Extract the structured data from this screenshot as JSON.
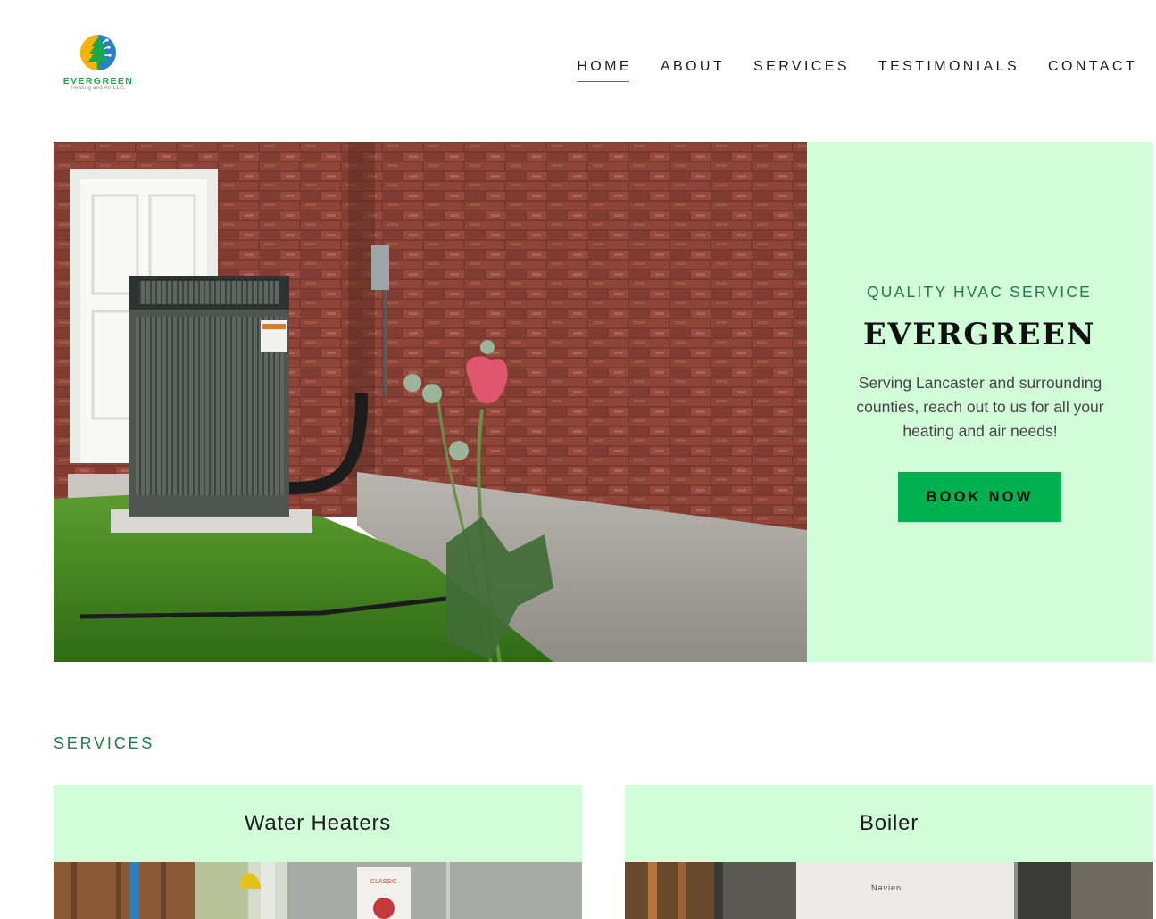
{
  "brand": {
    "name": "EVERGREEN",
    "tagline": "Heating and Air LLC.",
    "colors": {
      "green": "#1aa94a",
      "yellow": "#f5b400",
      "blue": "#2a7fc7"
    }
  },
  "nav": {
    "items": [
      {
        "label": "HOME",
        "active": true
      },
      {
        "label": "ABOUT",
        "active": false
      },
      {
        "label": "SERVICES",
        "active": false
      },
      {
        "label": "TESTIMONIALS",
        "active": false
      },
      {
        "label": "CONTACT",
        "active": false
      }
    ]
  },
  "hero": {
    "eyebrow": "QUALITY HVAC SERVICE",
    "title": "EVERGREEN",
    "description": "Serving Lancaster and surrounding counties, reach out to us for all your heating and air needs!",
    "cta_label": "BOOK NOW",
    "panel_color": "#d2fdd9",
    "cta_color": "#00b14f"
  },
  "services": {
    "label": "SERVICES",
    "cards": [
      {
        "title": "Water Heaters",
        "image_brand_text": "CLASSIC"
      },
      {
        "title": "Boiler",
        "image_brand_text": "Navien"
      }
    ]
  }
}
